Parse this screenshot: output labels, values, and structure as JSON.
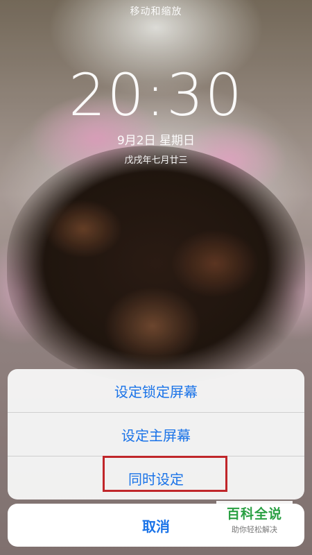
{
  "lockscreen": {
    "hint": "移动和缩放",
    "time": "20:30",
    "date": "9月2日 星期日",
    "lunar_date": "戊戌年七月廿三"
  },
  "action_sheet": {
    "options": [
      {
        "label": "设定锁定屏幕"
      },
      {
        "label": "设定主屏幕"
      },
      {
        "label": "同时设定"
      }
    ],
    "cancel_label": "取消"
  },
  "watermark": {
    "title": "百科全说",
    "subtitle": "助你轻松解决"
  },
  "colors": {
    "action_blue": "#1a73e8",
    "highlight_red": "#c0262a",
    "watermark_green": "#2aa043"
  }
}
